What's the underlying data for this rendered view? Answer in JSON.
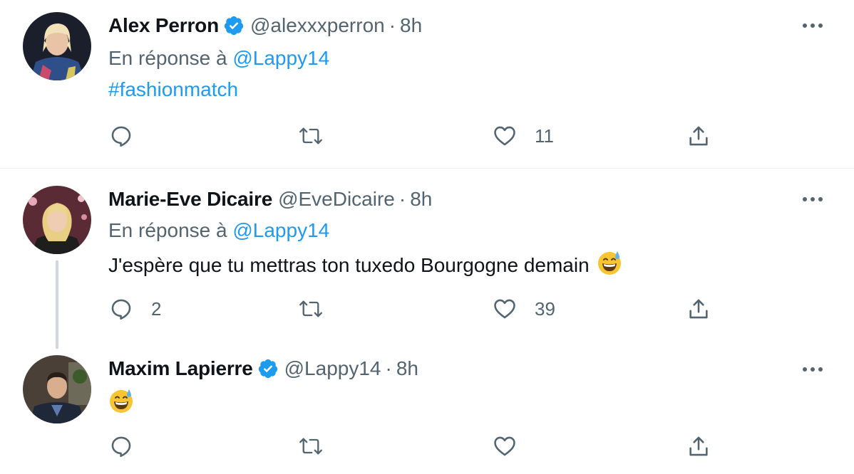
{
  "tweets": [
    {
      "name": "Alex Perron",
      "verified": true,
      "handle": "@alexxxperron",
      "separator": "·",
      "time": "8h",
      "reply_prefix": "En réponse à",
      "reply_to": "@Lappy14",
      "text": "#fashionmatch",
      "text_is_link": true,
      "reply_count": "",
      "retweet_count": "",
      "like_count": "11"
    },
    {
      "name": "Marie-Eve Dicaire",
      "verified": false,
      "handle": "@EveDicaire",
      "separator": "·",
      "time": "8h",
      "reply_prefix": "En réponse à",
      "reply_to": "@Lappy14",
      "text": "J'espère que tu mettras ton tuxedo Bourgogne demain",
      "emoji": "grinning-face-with-sweat",
      "reply_count": "2",
      "retweet_count": "",
      "like_count": "39"
    },
    {
      "name": "Maxim Lapierre",
      "verified": true,
      "handle": "@Lappy14",
      "separator": "·",
      "time": "8h",
      "text": "",
      "emoji": "grinning-face-with-sweat",
      "reply_count": "",
      "retweet_count": "",
      "like_count": ""
    }
  ],
  "colors": {
    "link": "#1d9bf0",
    "secondary_text": "#536471",
    "primary_text": "#0f1419",
    "verified_badge": "#1d9bf0"
  }
}
